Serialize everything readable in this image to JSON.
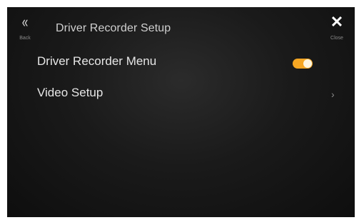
{
  "header": {
    "back_icon": "«",
    "back_label": "Back",
    "title": "Driver Recorder Setup",
    "close_icon": "✕",
    "close_label": "Close"
  },
  "items": [
    {
      "label": "Driver Recorder Menu",
      "control": "toggle",
      "state": "on"
    },
    {
      "label": "Video Setup",
      "control": "chevron",
      "chevron": "›"
    }
  ],
  "colors": {
    "toggle_on": "#f5a623",
    "background": "#1a1a1a",
    "text": "#e6e6e6"
  }
}
